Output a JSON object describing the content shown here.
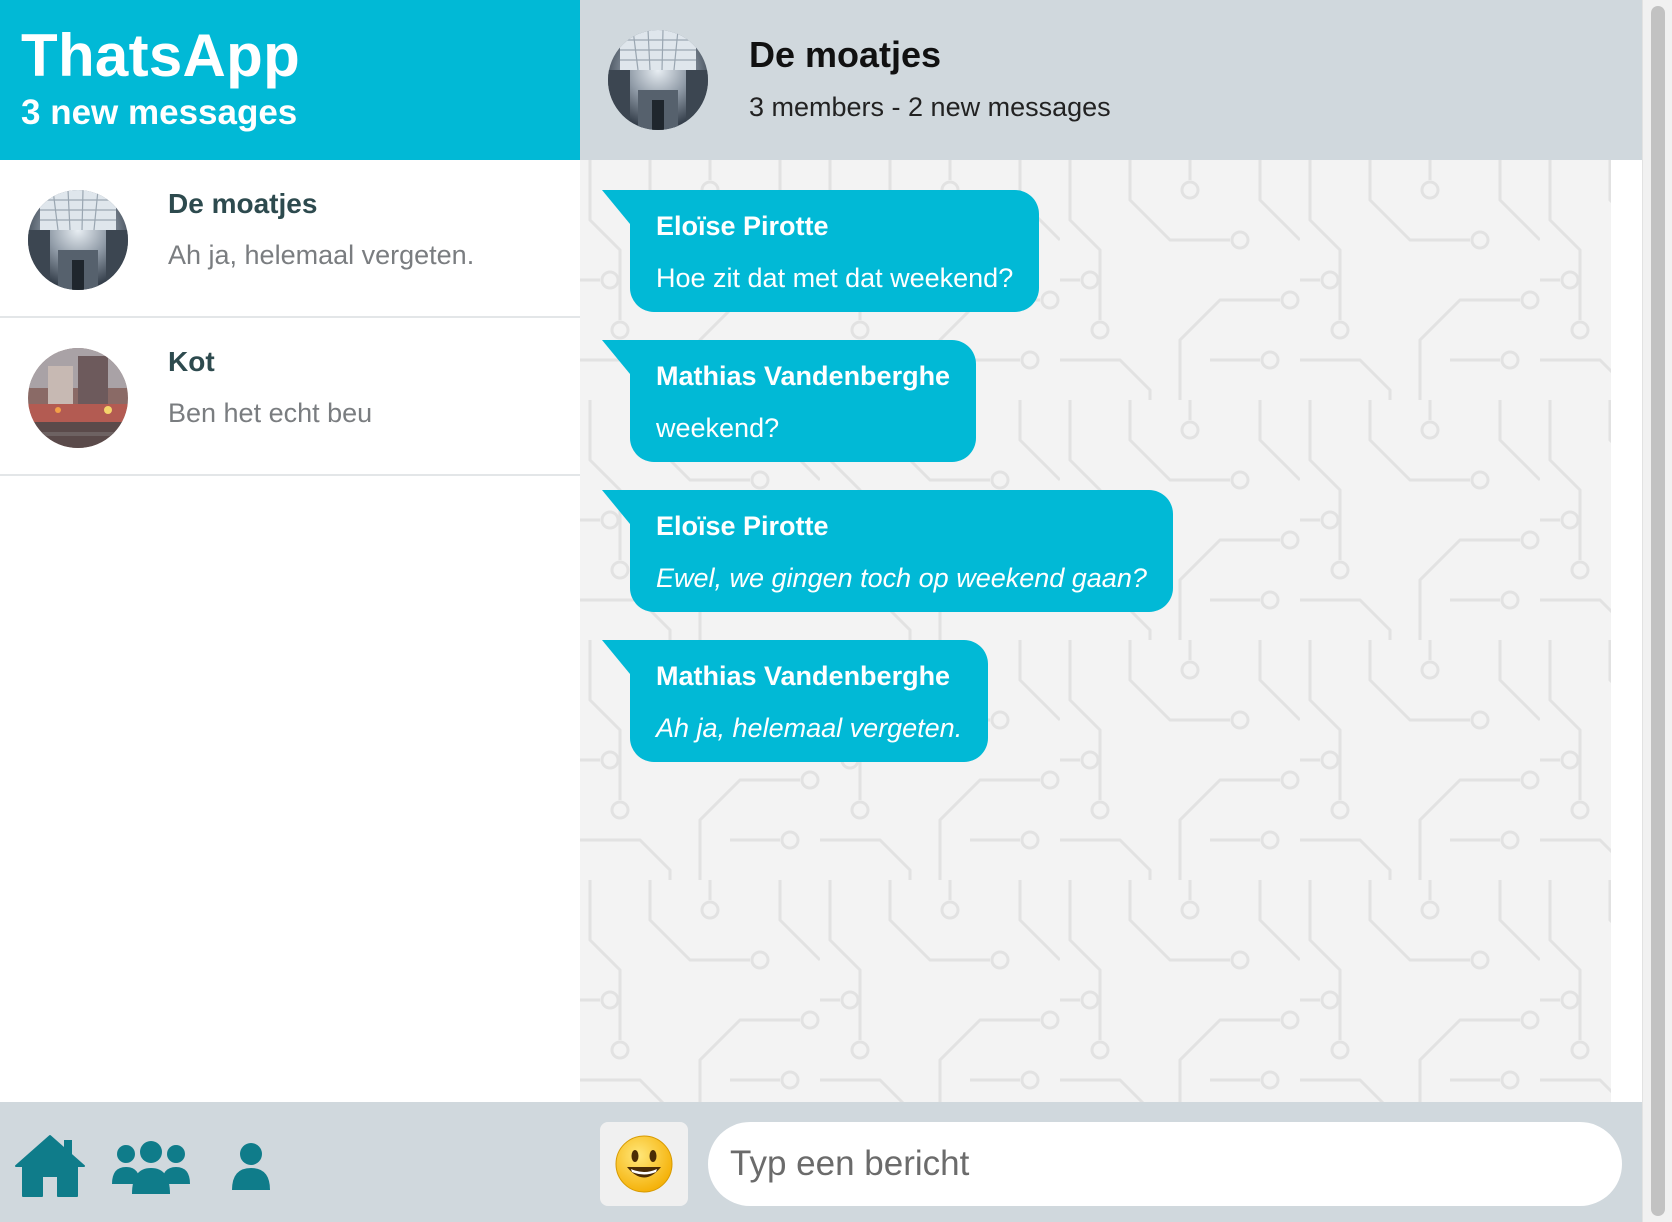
{
  "app": {
    "title": "ThatsApp",
    "subtitle": "3 new messages"
  },
  "conversations": [
    {
      "name": "De moatjes",
      "preview": "Ah ja, helemaal vergeten."
    },
    {
      "name": "Kot",
      "preview": "Ben het echt beu"
    }
  ],
  "chat": {
    "title": "De moatjes",
    "subtitle": "3 members - 2 new messages",
    "messages": [
      {
        "sender": "Eloïse Pirotte",
        "text": "Hoe zit dat met dat weekend?",
        "italic": false
      },
      {
        "sender": "Mathias Vandenberghe",
        "text": "weekend?",
        "italic": false
      },
      {
        "sender": "Eloïse Pirotte",
        "text": "Ewel, we gingen toch op weekend gaan?",
        "italic": true
      },
      {
        "sender": "Mathias Vandenberghe",
        "text": "Ah ja, helemaal vergeten.",
        "italic": true
      }
    ]
  },
  "compose": {
    "placeholder": "Typ een bericht",
    "value": ""
  },
  "nav": {
    "icons": [
      "home-icon",
      "group-icon",
      "user-icon"
    ]
  },
  "colors": {
    "accent": "#01b9d6",
    "nav_icon": "#0f7c8a",
    "header_bg": "#d0d8dd",
    "chat_bg": "#f3f3f3"
  }
}
